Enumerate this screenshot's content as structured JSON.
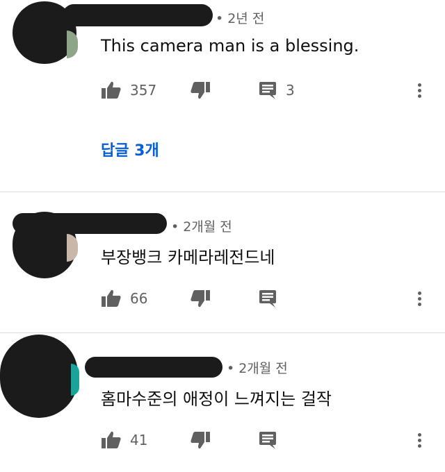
{
  "comments": [
    {
      "time": "2년 전",
      "text": "This camera man is a blessing.",
      "likes": "357",
      "reply_count": "3",
      "replies_link": "답글 3개"
    },
    {
      "time": "2개월 전",
      "text": "부장뱅크 카메라레전드네",
      "likes": "66"
    },
    {
      "time": "2개월 전",
      "text": "홈마수준의 애정이 느껴지는 걸작",
      "likes": "41"
    }
  ],
  "icons": {
    "like": "thumb-up-icon",
    "dislike": "thumb-down-icon",
    "reply": "comment-icon",
    "menu": "more-vert-icon"
  },
  "colors": {
    "text": "#0f0f0f",
    "meta": "#606060",
    "link": "#065fd4",
    "redaction": "#1b1b1b",
    "divider": "#dcdcdc"
  }
}
